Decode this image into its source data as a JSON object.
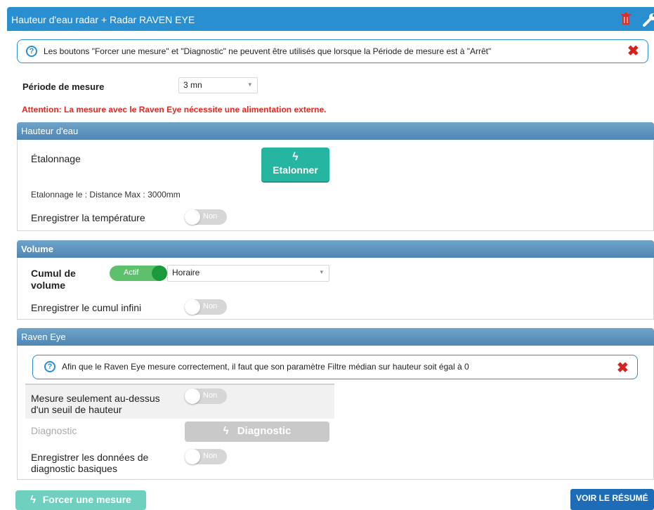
{
  "header": {
    "title": "Hauteur d'eau radar + Radar RAVEN EYE",
    "delete_icon": "trash-icon",
    "settings_icon": "wrench-icon"
  },
  "info_top": {
    "icon": "?",
    "text": "Les boutons \"Forcer une mesure\" et \"Diagnostic\" ne peuvent être utilisés que lorsque la Période de mesure est à \"Arrêt\"",
    "close": "✖"
  },
  "periode": {
    "label": "Période de mesure",
    "value": "3 mn",
    "caret": "▾"
  },
  "warning": "Attention: La mesure avec le Raven Eye nécessite une alimentation externe.",
  "hauteur": {
    "title": "Hauteur d'eau",
    "etalonnage_label": "Étalonnage",
    "etalonner_icon": "ϟ",
    "etalonner_label": "Etalonner",
    "etalonnage_info": "Etalonnage le : Distance Max : 3000mm",
    "temperature_label": "Enregistrer la température",
    "temperature_toggle": "Non"
  },
  "volume": {
    "title": "Volume",
    "cumul_label_1": "Cumul de",
    "cumul_label_2": "volume",
    "cumul_toggle": "Actif",
    "cumul_select": "Horaire",
    "caret": "▾",
    "infini_label": "Enregistrer le cumul infini",
    "infini_toggle": "Non"
  },
  "raven": {
    "title": "Raven Eye",
    "info_icon": "?",
    "info_text": "Afin que le Raven Eye mesure correctement, il faut que son paramètre Filtre médian sur hauteur soit égal à 0",
    "info_close": "✖",
    "seuil_label_1": "Mesure seulement au-dessus",
    "seuil_label_2": "d'un seuil de hauteur",
    "seuil_toggle": "Non",
    "diagnostic_label": "Diagnostic",
    "diagnostic_icon": "ϟ",
    "diagnostic_button": "Diagnostic",
    "donnees_label_1": "Enregistrer les données de",
    "donnees_label_2": "diagnostic basiques",
    "donnees_toggle": "Non"
  },
  "footer": {
    "forcer_icon": "ϟ",
    "forcer_label": "Forcer une mesure",
    "voir_label": "VOIR LE RÉSUMÉ"
  },
  "colors": {
    "header": "#2a8fd1",
    "warning": "#e4261f",
    "teal_button": "#25b5a0",
    "voir_button": "#1e6bb8",
    "toggle_on": "#5cc06c"
  }
}
